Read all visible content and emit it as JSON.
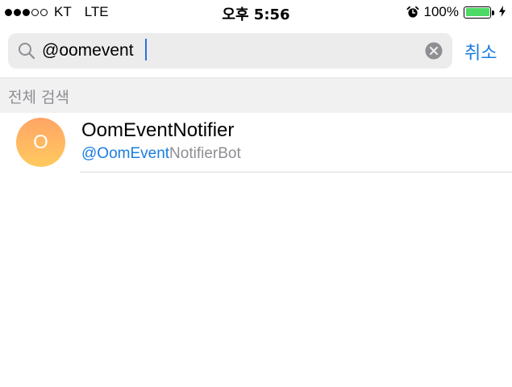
{
  "status_bar": {
    "signal_full": 3,
    "signal_empty": 2,
    "carrier": "KT",
    "network": "LTE",
    "time": "오후 5:56",
    "battery_percent": "100%",
    "battery_level": 1.0,
    "icons": [
      "alarm-icon",
      "battery-icon",
      "charging-bolt-icon"
    ],
    "battery_color": "#4cd964"
  },
  "search": {
    "query": "@oomevent",
    "cancel_label": "취소",
    "icons": [
      "search-icon",
      "clear-icon"
    ]
  },
  "section": {
    "title": "전체 검색"
  },
  "results": [
    {
      "avatar_letter": "O",
      "name": "OomEventNotifier",
      "username_match": "@OomEvent",
      "username_rest": "NotifierBot",
      "avatar_gradient": [
        "#ffa566",
        "#ffc95e"
      ]
    }
  ],
  "colors": {
    "accent": "#1a7de0",
    "secondary_text": "#8e8e93",
    "search_bg": "#ececed",
    "section_bg": "#f1f1f2"
  }
}
